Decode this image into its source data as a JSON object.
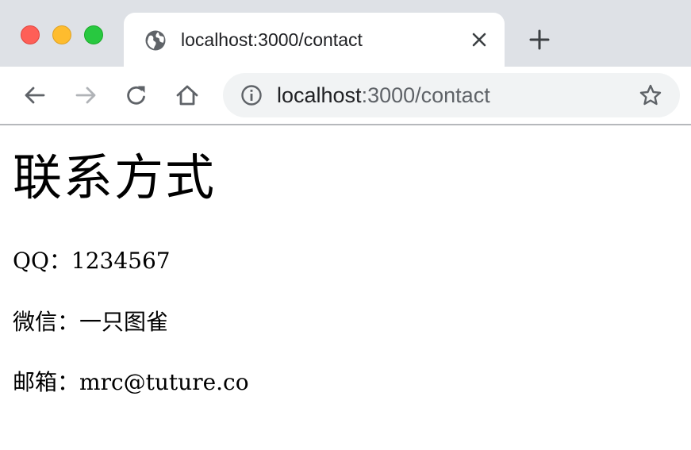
{
  "tab": {
    "title": "localhost:3000/contact"
  },
  "address_bar": {
    "host": "localhost",
    "path": ":3000/contact"
  },
  "page": {
    "title": "联系方式",
    "contacts": [
      {
        "label": "QQ：",
        "value": "1234567"
      },
      {
        "label": "微信：",
        "value": "一只图雀"
      },
      {
        "label": "邮箱：",
        "value": "mrc@tuture.co"
      }
    ]
  },
  "colors": {
    "tabstrip_bg": "#dee1e6",
    "omnibox_bg": "#f1f3f4",
    "traffic_close": "#fe5f57",
    "traffic_minimize": "#febc2e",
    "traffic_maximize": "#28c840",
    "icon": "#5f6368",
    "icon_disabled": "#b0b3b7"
  },
  "icons": {
    "favicon": "globe-icon",
    "tab_close": "close-icon",
    "new_tab": "plus-icon",
    "back": "arrow-left-icon",
    "forward": "arrow-right-icon",
    "reload": "reload-icon",
    "home": "home-icon",
    "site_info": "info-icon",
    "bookmark": "star-icon"
  },
  "state": {
    "forward_enabled": false
  }
}
